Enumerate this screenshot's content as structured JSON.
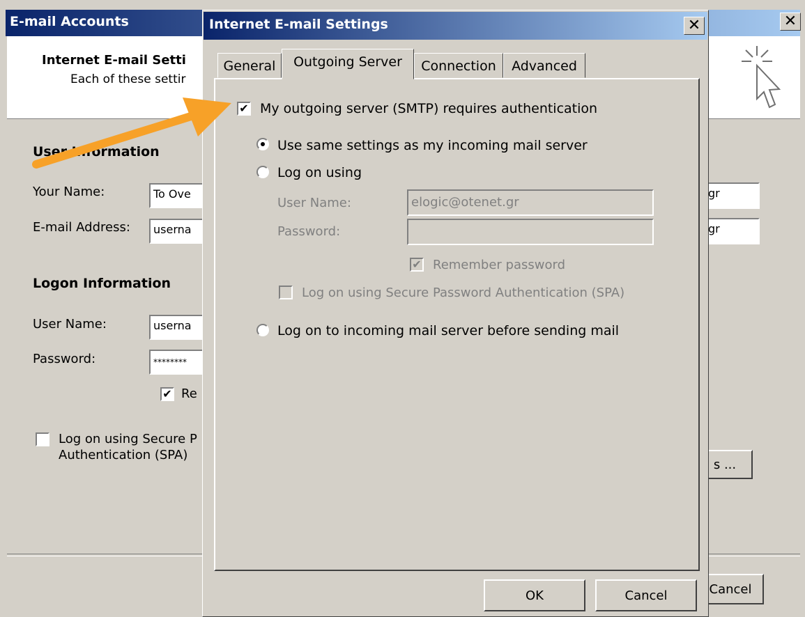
{
  "back_window": {
    "title": "E-mail Accounts",
    "close_glyph": "✕",
    "header_title": "Internet E-mail Setti",
    "header_subtitle": "Each of these settir",
    "user_info_heading": "User Information",
    "your_name_label": "Your Name:",
    "your_name_value": "To Ove",
    "email_label": "E-mail Address:",
    "email_value": "userna",
    "right_field_1": "gr",
    "right_field_2": "gr",
    "logon_info_heading": "Logon Information",
    "user_name_label": "User Name:",
    "user_name_value": "userna",
    "password_label": "Password:",
    "password_value": "********",
    "remember_label": "Re",
    "spa_label_line1": "Log on using Secure P",
    "spa_label_line2": "Authentication (SPA)",
    "more_settings_button": "s ...",
    "cancel_button": "Cancel"
  },
  "dialog": {
    "title": "Internet E-mail Settings",
    "close_glyph": "✕",
    "tabs": [
      {
        "label": "General"
      },
      {
        "label": "Outgoing Server"
      },
      {
        "label": "Connection"
      },
      {
        "label": "Advanced"
      }
    ],
    "smtp_auth_label": "My outgoing server (SMTP) requires authentication",
    "smtp_auth_checked": true,
    "same_settings_label": "Use same settings as my incoming mail server",
    "log_on_using_label": "Log on using",
    "user_name_label": "User Name:",
    "user_name_value": "elogic@otenet.gr",
    "password_label": "Password:",
    "password_value": "",
    "remember_password_label": "Remember password",
    "spa_label": "Log on using Secure Password Authentication (SPA)",
    "log_on_incoming_label": "Log on to incoming mail server before sending mail",
    "ok_button": "OK",
    "cancel_button": "Cancel"
  },
  "colors": {
    "titlebar_start": "#0a246a",
    "titlebar_end": "#a6caf0",
    "annotation_arrow": "#f7a128"
  }
}
